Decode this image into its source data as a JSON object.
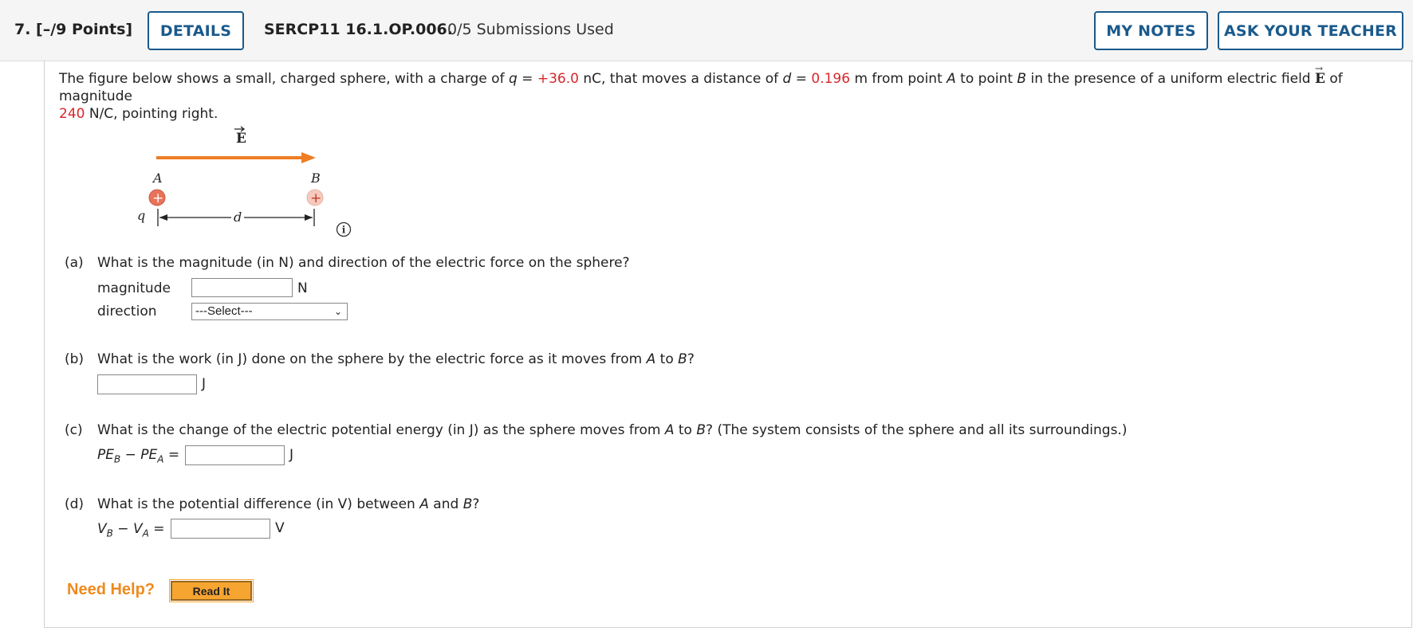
{
  "header": {
    "question_number": "7.  [–/9 Points]",
    "details_label": "DETAILS",
    "problem_code": "SERCP11 16.1.OP.006.",
    "submissions": "0/5 Submissions Used",
    "my_notes_label": "MY NOTES",
    "ask_teacher_label": "ASK YOUR TEACHER"
  },
  "problem": {
    "intro_1": "The figure below shows a small, charged sphere, with a charge of ",
    "q_sym": "q",
    "eq": " = ",
    "q_value": "+36.0",
    "q_unit": " nC, that moves a distance of ",
    "d_sym": "d",
    "d_value": "0.196",
    "d_unit_pre": " m from point ",
    "point_a": "A",
    "to_point": " to point ",
    "point_b": "B",
    "field_text": " in the presence of a uniform electric field ",
    "field_sym": "E",
    "of_magnitude": " of magnitude",
    "e_value": "240",
    "e_unit": " N/C, pointing right."
  },
  "figure": {
    "field_label": "E",
    "label_a": "A",
    "label_b": "B",
    "label_q": "q",
    "label_d": "d",
    "plus": "+",
    "info": "i",
    "colors": {
      "arrow": "#ef7d22",
      "sphere_a": "#e8735a",
      "sphere_b": "#f6c9bd"
    }
  },
  "parts": {
    "a": {
      "label": "(a)",
      "question": "What is the magnitude (in N) and direction of the electric force on the sphere?",
      "magnitude_label": "magnitude",
      "magnitude_value": "",
      "magnitude_unit": "N",
      "direction_label": "direction",
      "direction_selected": "---Select---"
    },
    "b": {
      "label": "(b)",
      "question_1": "What is the work (in J) done on the sphere by the electric force as it moves from ",
      "question_a": "A",
      "question_to": " to ",
      "question_b": "B",
      "question_end": "?",
      "value": "",
      "unit": "J"
    },
    "c": {
      "label": "(c)",
      "question_1": "What is the change of the electric potential energy (in J) as the sphere moves from ",
      "question_a": "A",
      "question_to": " to ",
      "question_b": "B",
      "question_end": "? (The system consists of the sphere and all its surroundings.)",
      "lhs_pe": "PE",
      "lhs_sub_b": "B",
      "lhs_minus": " − ",
      "lhs_pe2": "PE",
      "lhs_sub_a": "A",
      "lhs_eq": " =",
      "value": "",
      "unit": "J"
    },
    "d": {
      "label": "(d)",
      "question_1": "What is the potential difference (in V) between ",
      "question_a": "A",
      "question_and": " and ",
      "question_b": "B",
      "question_end": "?",
      "lhs_v": "V",
      "lhs_sub_b": "B",
      "lhs_minus": " − ",
      "lhs_v2": "V",
      "lhs_sub_a": "A",
      "lhs_eq": " =",
      "value": "",
      "unit": "V"
    }
  },
  "help": {
    "need_help": "Need Help?",
    "read_it": "Read It"
  }
}
